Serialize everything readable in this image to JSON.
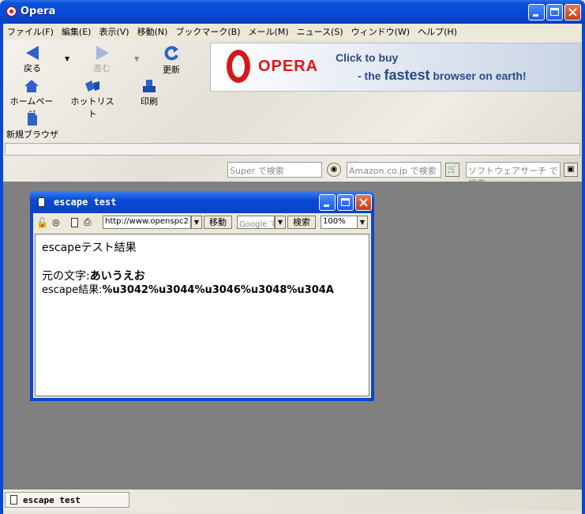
{
  "window": {
    "title": "Opera"
  },
  "menu": [
    "ファイル(F)",
    "編集(E)",
    "表示(V)",
    "移動(N)",
    "ブックマーク(B)",
    "メール(M)",
    "ニュース(S)",
    "ウィンドウ(W)",
    "ヘルプ(H)"
  ],
  "toolbar": {
    "back": "戻る",
    "forward": "進む",
    "reload": "更新",
    "home": "ホームページ",
    "hotlist": "ホットリスト",
    "print": "印刷",
    "new_browser": "新規ブラウザ"
  },
  "banner": {
    "brand": "OPERA",
    "line1": "Click to buy",
    "line2_prefix": "- the ",
    "line2_bold": "fastest",
    "line2_suffix": " browser on earth!"
  },
  "search": {
    "super_placeholder": "Super で検索",
    "amazon_placeholder": "Amazon.co.jp で検索",
    "software_placeholder": "ソフトウェアサーチ で検索"
  },
  "child_window": {
    "title": "escape test",
    "address": "http://www.openspc2",
    "go_label": "移動",
    "search_engine": "Google で",
    "search_label": "検索",
    "zoom": "100%",
    "content": {
      "heading": "escapeテスト結果",
      "original_label": "元の文字:",
      "original_value": "あいうえお",
      "result_label": "escape結果:",
      "result_value": "%u3042%u3044%u3046%u3048%u304A"
    }
  },
  "taskbar": {
    "item": "escape test"
  },
  "colors": {
    "titlebar": "#0a52dc",
    "workspace": "#808080",
    "close_button": "#c83c14",
    "brand_red": "#d81818"
  }
}
